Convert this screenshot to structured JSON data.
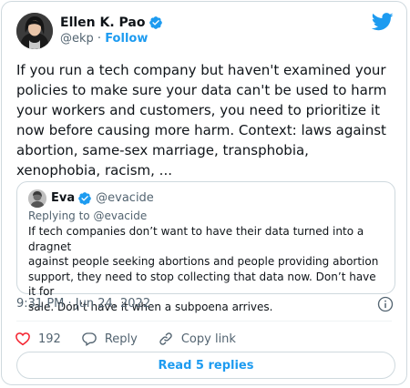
{
  "author": {
    "name": "Ellen K. Pao",
    "handle": "@ekp",
    "separator": "·",
    "follow_label": "Follow",
    "verified": true,
    "avatar_icon": "profile-photo"
  },
  "tweet": {
    "text": "If you run a tech company but haven't examined your\npolicies to make sure your data can't be used to harm\nyour workers and customers, you need to prioritize it\nnow before causing more harm. Context: laws against\nabortion, same-sex marriage, transphobia,\nxenophobia, racism, ..."
  },
  "quoted_tweet": {
    "name": "Eva",
    "handle": "@evacide",
    "verified": true,
    "replying_to": "Replying to @evacide",
    "text": "If tech companies don’t want to have their data turned into a dragnet\nagainst people seeking abortions and people providing abortion\nsupport, they need to stop collecting that data now. Don’t have it for\nsale. Don’t have it when a subpoena arrives."
  },
  "timestamp": "9:31 PM · Jun 24, 2022",
  "actions": {
    "like_count": "192",
    "reply_label": "Reply",
    "copy_link_label": "Copy link"
  },
  "read_replies_label": "Read 5 replies",
  "colors": {
    "accent": "#1d9bf0",
    "like_icon": "#f4212e",
    "secondary_text": "#536471",
    "border": "#cfd9de"
  },
  "icons": [
    "verified-badge-icon",
    "twitter-bird-icon",
    "info-icon",
    "heart-icon",
    "reply-bubble-icon",
    "link-icon"
  ]
}
